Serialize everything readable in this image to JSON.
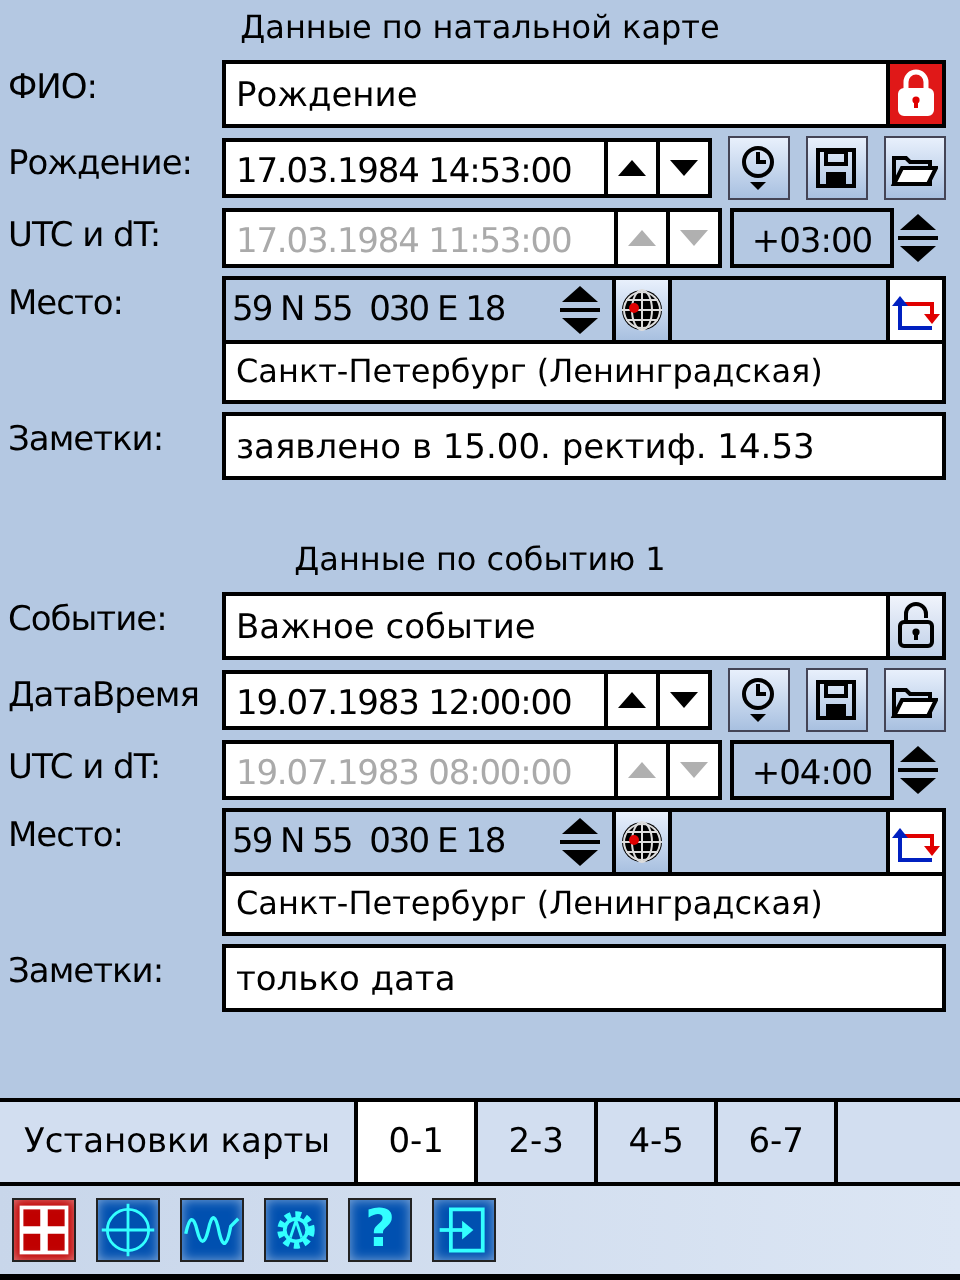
{
  "sections": [
    {
      "title": "Данные по натальной карте",
      "name": {
        "label": "ФИО:",
        "value": "Рождение",
        "locked": true
      },
      "date": {
        "label": "Рождение:",
        "value": "17.03.1984 14:53:00"
      },
      "utc": {
        "label": "UTC и dT:",
        "value": "17.03.1984 11:53:00",
        "disabled": true,
        "offset": "+03:00"
      },
      "place": {
        "label": "Место:",
        "coords": "59 N 55  030 E 18",
        "city": "Санкт-Петербург (Ленинградская)"
      },
      "notes": {
        "label": "Заметки:",
        "value": "заявлено в 15.00. ректиф. 14.53"
      }
    },
    {
      "title": "Данные по событию 1",
      "name": {
        "label": "Событие:",
        "value": "Важное событие",
        "locked": false
      },
      "date": {
        "label": "ДатаВремя",
        "value": "19.07.1983 12:00:00"
      },
      "utc": {
        "label": "UTC и dT:",
        "value": "19.07.1983 08:00:00",
        "disabled": true,
        "offset": "+04:00"
      },
      "place": {
        "label": "Место:",
        "coords": "59 N 55  030 E 18",
        "city": "Санкт-Петербург (Ленинградская)"
      },
      "notes": {
        "label": "Заметки:",
        "value": "только дата"
      }
    }
  ],
  "tabs": [
    {
      "label": "Установки карты",
      "selected": false
    },
    {
      "label": "0-1",
      "selected": true
    },
    {
      "label": "2-3",
      "selected": false
    },
    {
      "label": "4-5",
      "selected": false
    },
    {
      "label": "6-7",
      "selected": false
    }
  ],
  "toolbar": [
    {
      "kind": "grid",
      "color": "#c00000"
    },
    {
      "kind": "crosshair",
      "color": "#0050b0"
    },
    {
      "kind": "wave",
      "color": "#0050b0"
    },
    {
      "kind": "gear",
      "color": "#0050b0"
    },
    {
      "kind": "help",
      "glyph": "?",
      "color": "#0050b0"
    },
    {
      "kind": "exit",
      "color": "#0050b0"
    }
  ]
}
